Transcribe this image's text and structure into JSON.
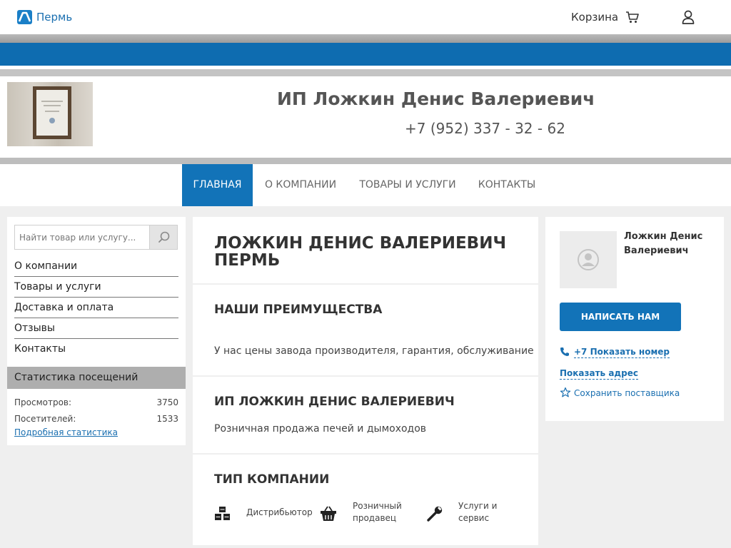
{
  "topbar": {
    "city": "Пермь",
    "cart_label": "Корзина",
    "icons": {
      "logo": "site-logo",
      "cart": "cart-icon",
      "user": "user-icon"
    }
  },
  "colors": {
    "brand_blue": "#1273b8",
    "link_blue": "#1a6fb0",
    "page_bg": "#efefef"
  },
  "header": {
    "company_name": "ИП Ложкин Денис Валериевич",
    "phone": "+7 (952) 337 - 32 - 62"
  },
  "nav": {
    "items": [
      {
        "label": "ГЛАВНАЯ"
      },
      {
        "label": "О КОМПАНИИ"
      },
      {
        "label": "ТОВАРЫ И УСЛУГИ"
      },
      {
        "label": "КОНТАКТЫ"
      }
    ]
  },
  "sidebar": {
    "search_placeholder": "Найти товар или услугу...",
    "menu": [
      {
        "label": "О компании"
      },
      {
        "label": "Товары и услуги"
      },
      {
        "label": "Доставка и оплата"
      },
      {
        "label": "Отзывы"
      },
      {
        "label": "Контакты"
      }
    ],
    "stats": {
      "title": "Статистика посещений",
      "views_label": "Просмотров:",
      "views_value": "3750",
      "visitors_label": "Посетителей:",
      "visitors_value": "1533",
      "details_link": "Подробная статистика"
    }
  },
  "main": {
    "title": "ЛОЖКИН ДЕНИС ВАЛЕРИЕВИЧ ПЕРМЬ",
    "advantages": {
      "heading": "НАШИ ПРЕИМУЩЕСТВА",
      "text": "У нас цены завода производителя, гарантия, обслуживание"
    },
    "company": {
      "heading": "ИП ЛОЖКИН ДЕНИС ВАЛЕРИЕВИЧ",
      "text": "Розничная продажа печей и дымоходов"
    },
    "types": {
      "heading": "ТИП КОМПАНИИ",
      "items": [
        {
          "label": "Дистрибьютор",
          "icon": "boxes-icon"
        },
        {
          "label": "Розничный продавец",
          "icon": "basket-icon"
        },
        {
          "label": "Услуги и сервис",
          "icon": "wrench-icon"
        }
      ]
    }
  },
  "contact": {
    "name": "Ложкин Денис Валериевич",
    "write_button": "НАПИСАТЬ НАМ",
    "phone_link": "+7 Показать номер",
    "address_link": "Показать адрес",
    "save_link": "Сохранить поставщика"
  }
}
